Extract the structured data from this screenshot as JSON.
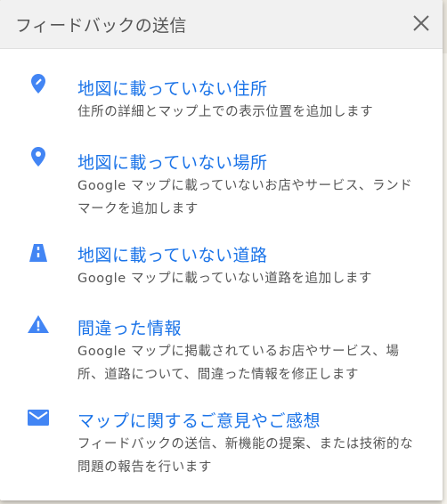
{
  "dialog": {
    "title": "フィードバックの送信",
    "close_icon": "close-icon"
  },
  "items": [
    {
      "icon": "pin-edit-icon",
      "title": "地図に載っていない住所",
      "description": "住所の詳細とマップ上での表示位置を追加します"
    },
    {
      "icon": "place-pin-icon",
      "title": "地図に載っていない場所",
      "description": "Google マップに載っていないお店やサービス、ランドマークを追加します"
    },
    {
      "icon": "road-icon",
      "title": "地図に載っていない道路",
      "description": "Google マップに載っていない道路を追加します"
    },
    {
      "icon": "warning-icon",
      "title": "間違った情報",
      "description": "Google マップに掲載されているお店やサービス、場所、道路について、間違った情報を修正します"
    },
    {
      "icon": "mail-icon",
      "title": "マップに関するご意見やご感想",
      "description": "フィードバックの送信、新機能の提案、または技術的な問題の報告を行います"
    }
  ],
  "colors": {
    "accent": "#1a73e8",
    "icon": "#4285f4",
    "text_secondary": "#555555",
    "header_bg": "#f1f1f1"
  }
}
